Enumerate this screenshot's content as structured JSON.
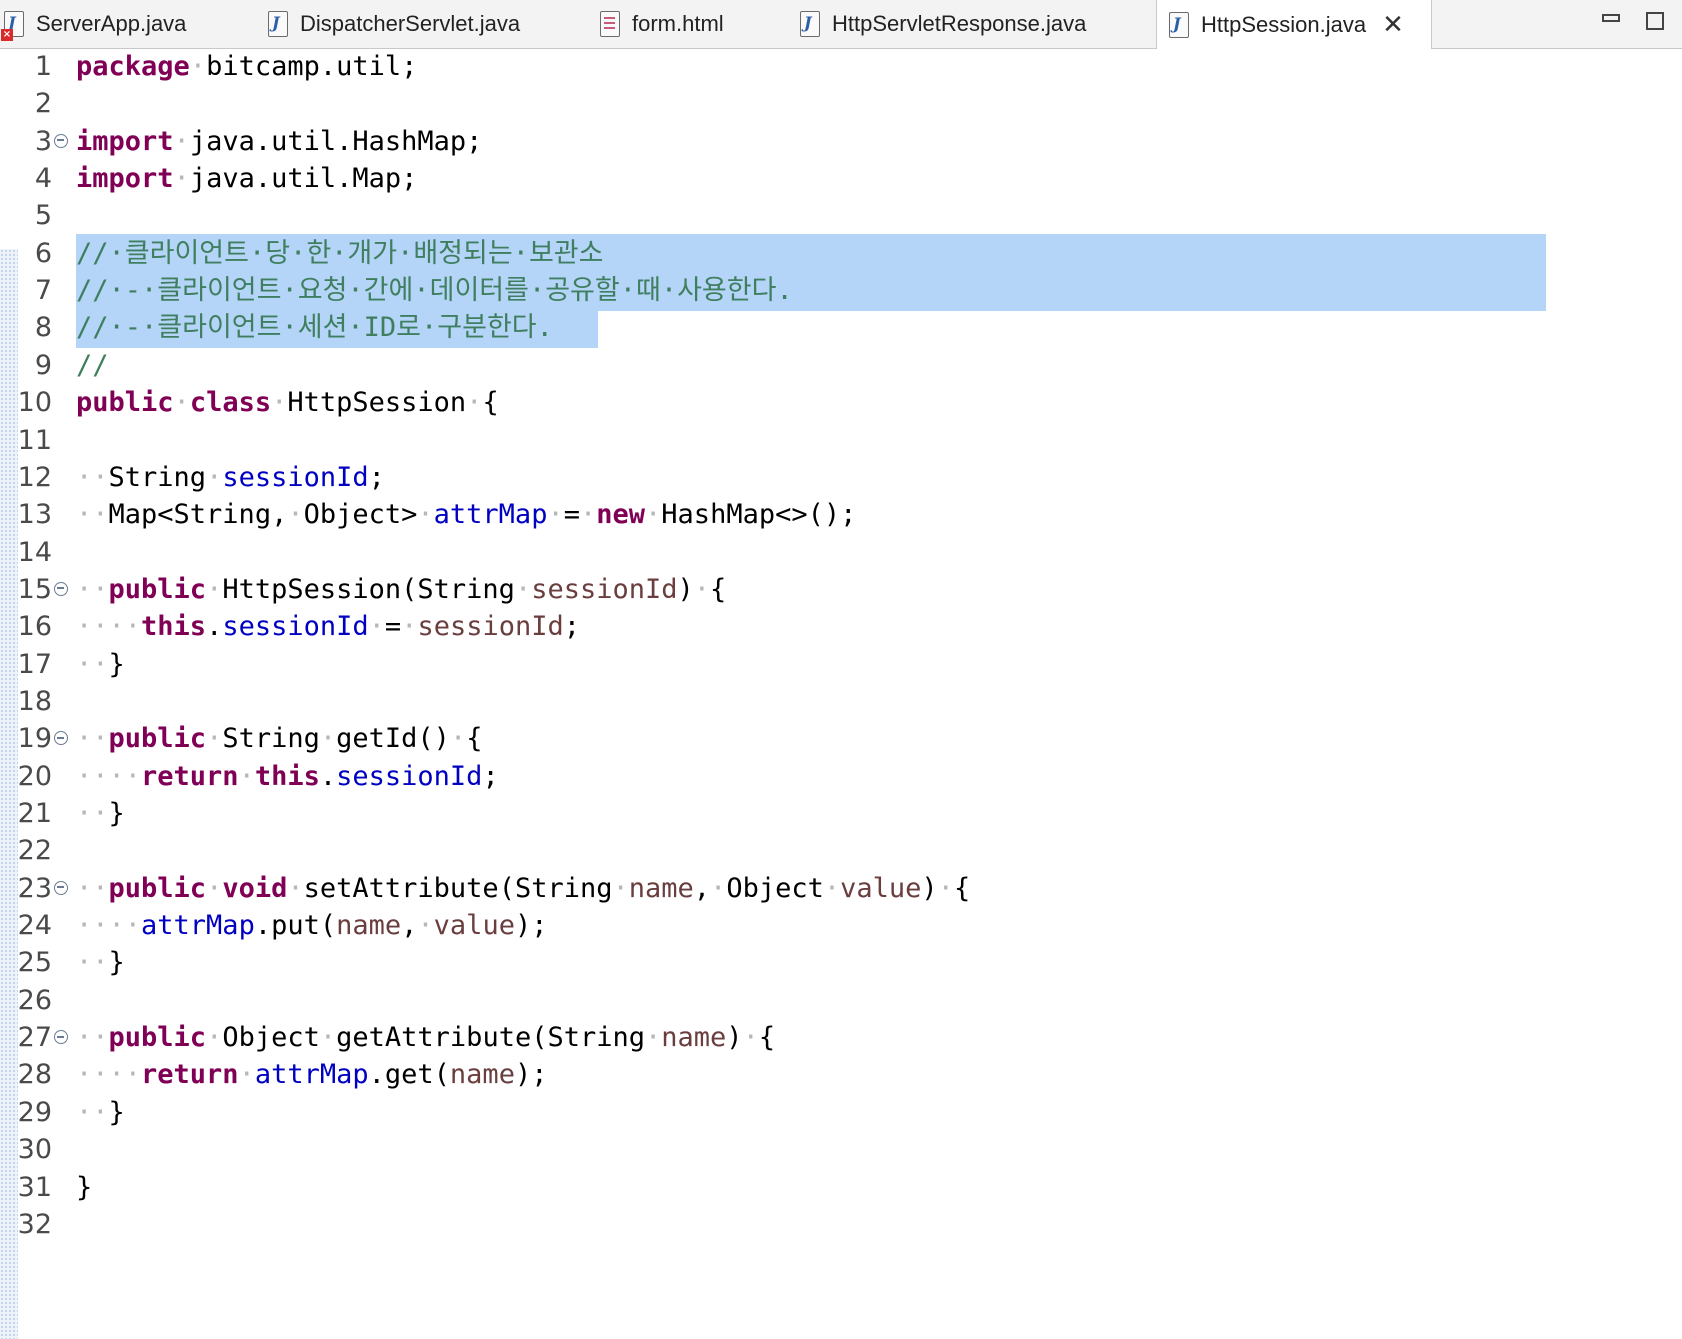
{
  "tabs": [
    {
      "label": "ServerApp.java",
      "icon": "java-file-error-icon"
    },
    {
      "label": "DispatcherServlet.java",
      "icon": "java-file-icon"
    },
    {
      "label": "form.html",
      "icon": "html-file-icon"
    },
    {
      "label": "HttpServletResponse.java",
      "icon": "java-file-icon"
    },
    {
      "label": "HttpSession.java",
      "icon": "java-file-icon",
      "active": true
    }
  ],
  "colors": {
    "keyword": "#7f0055",
    "field": "#0000c0",
    "parameter": "#6a3e3e",
    "comment": "#3f7f5f",
    "selection": "#b4d4f8"
  },
  "selected_lines": [
    6,
    7,
    8
  ],
  "lines": [
    {
      "n": "1",
      "tokens": [
        [
          "kw",
          "package"
        ],
        [
          "ws",
          "·"
        ],
        [
          "t",
          "bitcamp.util;"
        ]
      ]
    },
    {
      "n": "2",
      "tokens": []
    },
    {
      "n": "3",
      "fold": true,
      "tokens": [
        [
          "kw",
          "import"
        ],
        [
          "ws",
          "·"
        ],
        [
          "t",
          "java.util.HashMap;"
        ]
      ]
    },
    {
      "n": "4",
      "tokens": [
        [
          "kw",
          "import"
        ],
        [
          "ws",
          "·"
        ],
        [
          "t",
          "java.util.Map;"
        ]
      ]
    },
    {
      "n": "5",
      "tokens": []
    },
    {
      "n": "6",
      "tokens": [
        [
          "cmt",
          "//·클라이언트·당·한·개가·배정되는·보관소"
        ]
      ]
    },
    {
      "n": "7",
      "tokens": [
        [
          "cmt",
          "//·-·클라이언트·요청·간에·데이터를·공유할·때·사용한다."
        ]
      ]
    },
    {
      "n": "8",
      "tokens": [
        [
          "cmt",
          "//·-·클라이언트·세션·ID로·구분한다."
        ]
      ]
    },
    {
      "n": "9",
      "tokens": [
        [
          "cmt",
          "//"
        ]
      ]
    },
    {
      "n": "10",
      "tokens": [
        [
          "kw",
          "public"
        ],
        [
          "ws",
          "·"
        ],
        [
          "kw",
          "class"
        ],
        [
          "ws",
          "·"
        ],
        [
          "t",
          "HttpSession"
        ],
        [
          "ws",
          "·"
        ],
        [
          "t",
          "{"
        ]
      ]
    },
    {
      "n": "11",
      "tokens": []
    },
    {
      "n": "12",
      "tokens": [
        [
          "ws",
          "··"
        ],
        [
          "t",
          "String"
        ],
        [
          "ws",
          "·"
        ],
        [
          "fld",
          "sessionId"
        ],
        [
          "t",
          ";"
        ]
      ]
    },
    {
      "n": "13",
      "tokens": [
        [
          "ws",
          "··"
        ],
        [
          "t",
          "Map<String,"
        ],
        [
          "ws",
          "·"
        ],
        [
          "t",
          "Object>"
        ],
        [
          "ws",
          "·"
        ],
        [
          "fld",
          "attrMap"
        ],
        [
          "ws",
          "·"
        ],
        [
          "t",
          "="
        ],
        [
          "ws",
          "·"
        ],
        [
          "kw",
          "new"
        ],
        [
          "ws",
          "·"
        ],
        [
          "t",
          "HashMap<>();"
        ]
      ]
    },
    {
      "n": "14",
      "tokens": []
    },
    {
      "n": "15",
      "fold": true,
      "tokens": [
        [
          "ws",
          "··"
        ],
        [
          "kw",
          "public"
        ],
        [
          "ws",
          "·"
        ],
        [
          "t",
          "HttpSession(String"
        ],
        [
          "ws",
          "·"
        ],
        [
          "par",
          "sessionId"
        ],
        [
          "t",
          ")"
        ],
        [
          "ws",
          "·"
        ],
        [
          "t",
          "{"
        ]
      ]
    },
    {
      "n": "16",
      "tokens": [
        [
          "ws",
          "····"
        ],
        [
          "kw",
          "this"
        ],
        [
          "t",
          "."
        ],
        [
          "fld",
          "sessionId"
        ],
        [
          "ws",
          "·"
        ],
        [
          "t",
          "="
        ],
        [
          "ws",
          "·"
        ],
        [
          "par",
          "sessionId"
        ],
        [
          "t",
          ";"
        ]
      ]
    },
    {
      "n": "17",
      "tokens": [
        [
          "ws",
          "··"
        ],
        [
          "t",
          "}"
        ]
      ]
    },
    {
      "n": "18",
      "tokens": []
    },
    {
      "n": "19",
      "fold": true,
      "tokens": [
        [
          "ws",
          "··"
        ],
        [
          "kw",
          "public"
        ],
        [
          "ws",
          "·"
        ],
        [
          "t",
          "String"
        ],
        [
          "ws",
          "·"
        ],
        [
          "t",
          "getId()"
        ],
        [
          "ws",
          "·"
        ],
        [
          "t",
          "{"
        ]
      ]
    },
    {
      "n": "20",
      "tokens": [
        [
          "ws",
          "····"
        ],
        [
          "kw",
          "return"
        ],
        [
          "ws",
          "·"
        ],
        [
          "kw",
          "this"
        ],
        [
          "t",
          "."
        ],
        [
          "fld",
          "sessionId"
        ],
        [
          "t",
          ";"
        ]
      ]
    },
    {
      "n": "21",
      "tokens": [
        [
          "ws",
          "··"
        ],
        [
          "t",
          "}"
        ]
      ]
    },
    {
      "n": "22",
      "tokens": []
    },
    {
      "n": "23",
      "fold": true,
      "tokens": [
        [
          "ws",
          "··"
        ],
        [
          "kw",
          "public"
        ],
        [
          "ws",
          "·"
        ],
        [
          "kw",
          "void"
        ],
        [
          "ws",
          "·"
        ],
        [
          "t",
          "setAttribute(String"
        ],
        [
          "ws",
          "·"
        ],
        [
          "par",
          "name"
        ],
        [
          "t",
          ","
        ],
        [
          "ws",
          "·"
        ],
        [
          "t",
          "Object"
        ],
        [
          "ws",
          "·"
        ],
        [
          "par",
          "value"
        ],
        [
          "t",
          ")"
        ],
        [
          "ws",
          "·"
        ],
        [
          "t",
          "{"
        ]
      ]
    },
    {
      "n": "24",
      "tokens": [
        [
          "ws",
          "····"
        ],
        [
          "fld",
          "attrMap"
        ],
        [
          "t",
          ".put("
        ],
        [
          "par",
          "name"
        ],
        [
          "t",
          ","
        ],
        [
          "ws",
          "·"
        ],
        [
          "par",
          "value"
        ],
        [
          "t",
          ");"
        ]
      ]
    },
    {
      "n": "25",
      "tokens": [
        [
          "ws",
          "··"
        ],
        [
          "t",
          "}"
        ]
      ]
    },
    {
      "n": "26",
      "tokens": []
    },
    {
      "n": "27",
      "fold": true,
      "tokens": [
        [
          "ws",
          "··"
        ],
        [
          "kw",
          "public"
        ],
        [
          "ws",
          "·"
        ],
        [
          "t",
          "Object"
        ],
        [
          "ws",
          "·"
        ],
        [
          "t",
          "getAttribute(String"
        ],
        [
          "ws",
          "·"
        ],
        [
          "par",
          "name"
        ],
        [
          "t",
          ")"
        ],
        [
          "ws",
          "·"
        ],
        [
          "t",
          "{"
        ]
      ]
    },
    {
      "n": "28",
      "tokens": [
        [
          "ws",
          "····"
        ],
        [
          "kw",
          "return"
        ],
        [
          "ws",
          "·"
        ],
        [
          "fld",
          "attrMap"
        ],
        [
          "t",
          ".get("
        ],
        [
          "par",
          "name"
        ],
        [
          "t",
          ");"
        ]
      ]
    },
    {
      "n": "29",
      "tokens": [
        [
          "ws",
          "··"
        ],
        [
          "t",
          "}"
        ]
      ]
    },
    {
      "n": "30",
      "tokens": []
    },
    {
      "n": "31",
      "tokens": [
        [
          "t",
          "}"
        ]
      ]
    },
    {
      "n": "32",
      "tokens": []
    }
  ]
}
